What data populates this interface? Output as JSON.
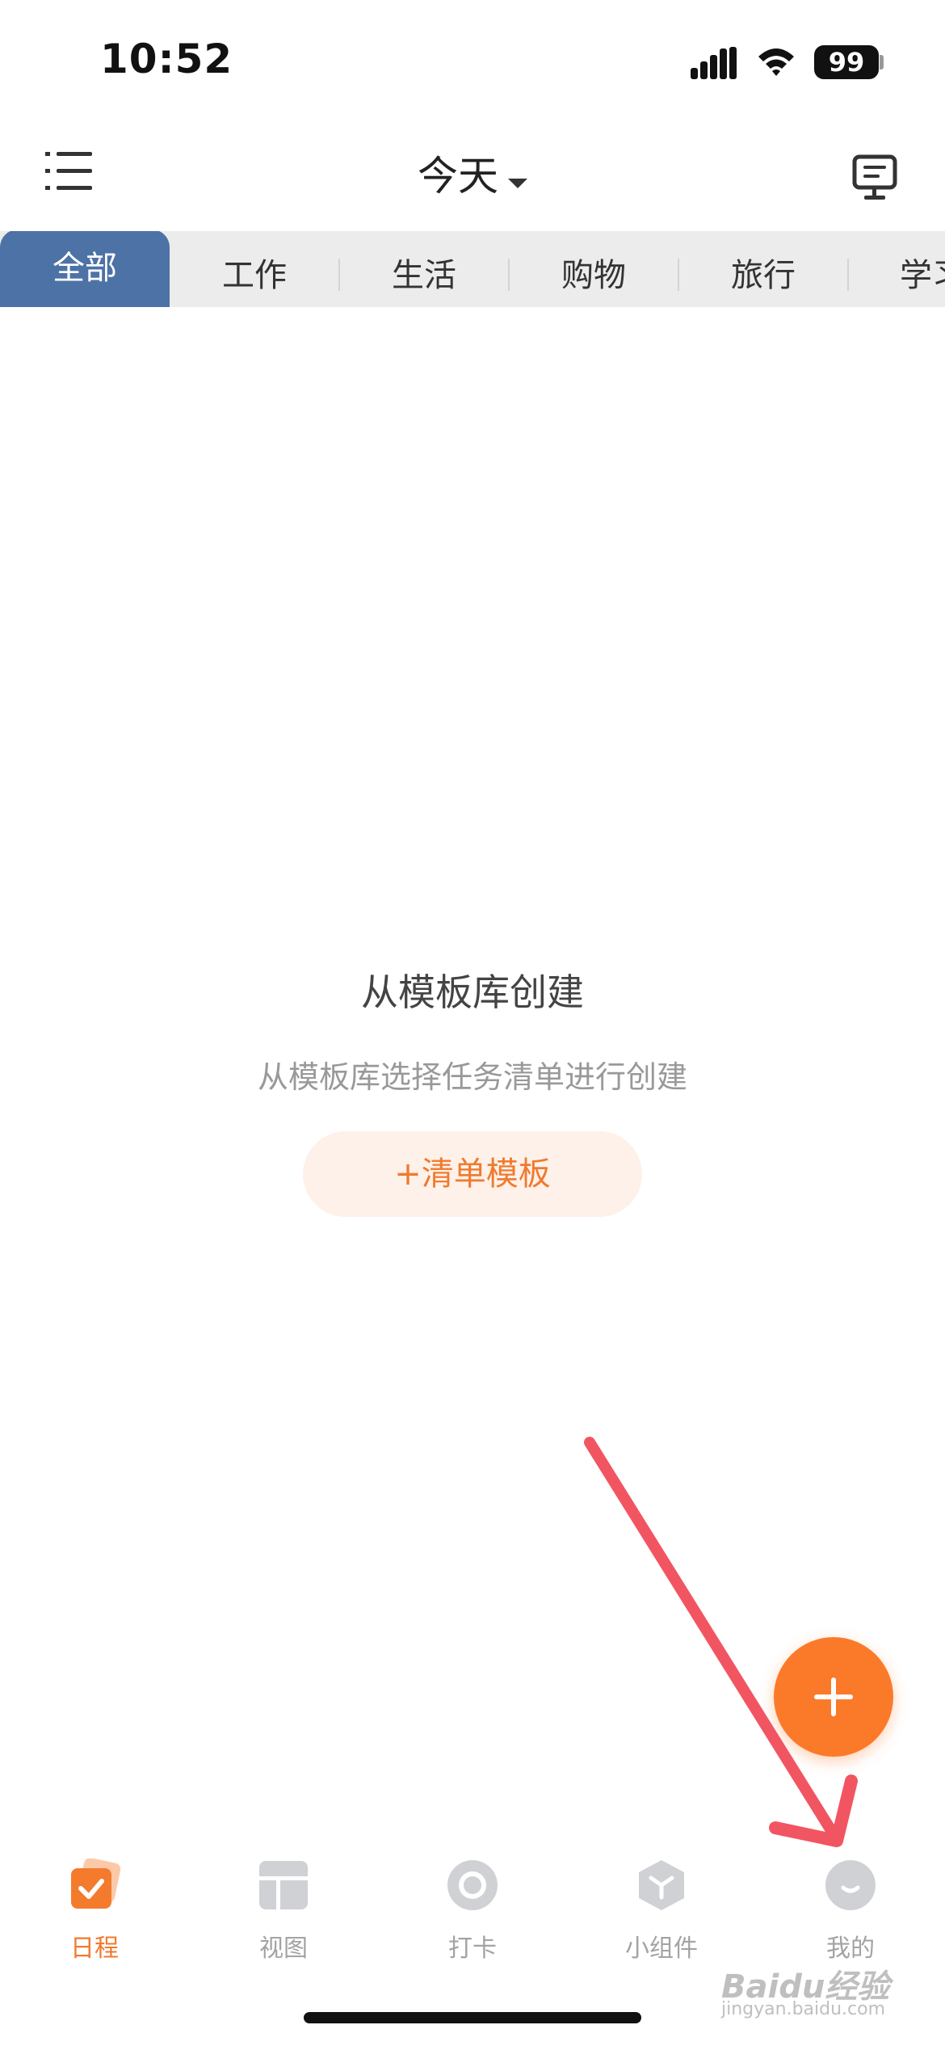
{
  "status_bar": {
    "time": "10:52",
    "battery": "99"
  },
  "header": {
    "title": "今天",
    "menu_icon": "menu-list-icon",
    "message_icon": "message-board-icon"
  },
  "categories": [
    {
      "label": "全部",
      "active": true
    },
    {
      "label": "工作",
      "active": false
    },
    {
      "label": "生活",
      "active": false
    },
    {
      "label": "购物",
      "active": false
    },
    {
      "label": "旅行",
      "active": false
    },
    {
      "label": "学习",
      "active": false
    }
  ],
  "empty_state": {
    "title": "从模板库创建",
    "subtitle": "从模板库选择任务清单进行创建",
    "button_label": "+清单模板"
  },
  "fab": {
    "icon": "plus-icon",
    "color": "#fb7a2a"
  },
  "tabbar": [
    {
      "label": "日程",
      "icon": "schedule-check-icon",
      "active": true
    },
    {
      "label": "视图",
      "icon": "view-layout-icon",
      "active": false
    },
    {
      "label": "打卡",
      "icon": "check-in-circle-icon",
      "active": false
    },
    {
      "label": "小组件",
      "icon": "widget-cube-icon",
      "active": false
    },
    {
      "label": "我的",
      "icon": "profile-smile-icon",
      "active": false
    }
  ],
  "watermark": {
    "brand": "Baidu经验",
    "url": "jingyan.baidu.com"
  },
  "colors": {
    "accent": "#f07a2e",
    "tab_active": "#4d72a6",
    "annotation_arrow": "#f25562"
  }
}
